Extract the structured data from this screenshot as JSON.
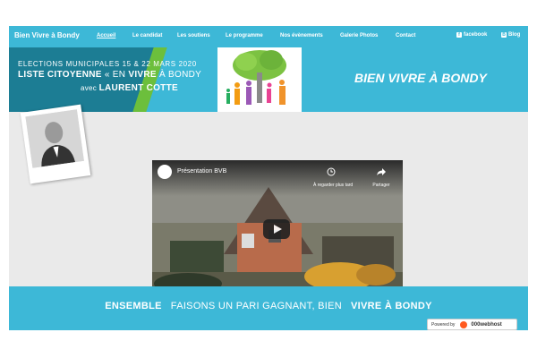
{
  "nav": {
    "brand": "Bien Vivre à Bondy",
    "items": [
      "Accueil",
      "Le candidat",
      "Les soutiens",
      "Le programme",
      "Nos évènements",
      "Galerie Photos",
      "Contact"
    ],
    "facebook": "facebook",
    "blog": "Blog"
  },
  "banner": {
    "line1": "ELECTIONS MUNICIPALES 15 & 22 MARS 2020",
    "line2_a": "LISTE CITOYENNE",
    "line2_b": " « EN ",
    "line2_c": "VIVRE",
    "line2_d": " À BONDY",
    "line3_a": "avec ",
    "line3_b": "LAURENT COTTE",
    "slogan": "BIEN VIVRE À BONDY"
  },
  "video": {
    "title": "Présentation BVB",
    "watch_later": "À regarder plus tard",
    "share": "Partager"
  },
  "footer": {
    "part1": "ENSEMBLE",
    "part2": "FAISONS UN PARI GAGNANT, BIEN",
    "part3": "VIVRE À BONDY"
  },
  "powered": {
    "label": "Powered by",
    "host": "000webhost"
  },
  "colors": {
    "accent": "#3db8d7",
    "dark_teal": "#1c7d94",
    "green": "#6cbf3c"
  }
}
